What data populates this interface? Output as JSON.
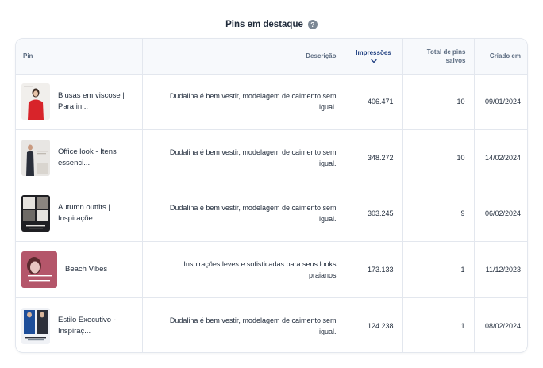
{
  "section": {
    "title": "Pins em destaque",
    "help_icon": "?"
  },
  "table": {
    "headers": {
      "pin": "Pin",
      "description": "Descrição",
      "impressions": "Impressões",
      "total_saved_1": "Total de pins",
      "total_saved_2": "salvos",
      "created": "Criado em"
    },
    "sort": {
      "column": "Impressões",
      "direction": "descending"
    },
    "rows": [
      {
        "title_1": "Blusas em viscose |",
        "title_2": "Para in...",
        "description_1": "Dudalina é bem vestir, modelagem de caimento sem",
        "description_2": "igual.",
        "impressions": "406.471",
        "saved": "10",
        "created": "09/01/2024",
        "thumb_colors": [
          "#f1efec",
          "#d8242a",
          "#3a2a22"
        ]
      },
      {
        "title_1": "Office look - Itens",
        "title_2": "essenci...",
        "description_1": "Dudalina é bem vestir, modelagem de caimento sem",
        "description_2": "igual.",
        "impressions": "348.272",
        "saved": "10",
        "created": "14/02/2024",
        "thumb_colors": [
          "#e8e6e3",
          "#2a2f3a",
          "#bfbab2"
        ],
        "thumb_text": "OFFICE LOOK"
      },
      {
        "title_1": "Autumn outfits |",
        "title_2": "Inspiraçõe...",
        "description_1": "Dudalina é bem vestir, modelagem de caimento sem",
        "description_2": "igual.",
        "impressions": "303.245",
        "saved": "9",
        "created": "06/02/2024",
        "thumb_colors": [
          "#1f1f23",
          "#e5e2de",
          "#6e6a66"
        ],
        "thumb_text": "AUTUMN OUTFITS"
      },
      {
        "title_1": "Beach Vibes",
        "title_2": "",
        "description_1": "Inspirações leves e sofisticadas para seus looks",
        "description_2": "praianos",
        "impressions": "173.133",
        "saved": "1",
        "created": "11/12/2023",
        "thumb_colors": [
          "#b4566a",
          "#e7c6c2",
          "#ffffff"
        ],
        "thumb_text": "beach vibes"
      },
      {
        "title_1": "Estilo Executivo -",
        "title_2": "Inspiraç...",
        "description_1": "Dudalina é bem vestir, modelagem de caimento sem",
        "description_2": "igual.",
        "impressions": "124.238",
        "saved": "1",
        "created": "08/02/2024",
        "thumb_colors": [
          "#f0f2f6",
          "#1d4e9a",
          "#2b2f3a"
        ],
        "thumb_text": "ESTILO EXECUTIVO"
      }
    ]
  },
  "colors": {
    "header_bg": "#f7f9fc",
    "border": "#e3e7ee",
    "active_sort": "#1f3f80",
    "text": "#1f2a3a",
    "muted_header": "#5b6b80"
  }
}
